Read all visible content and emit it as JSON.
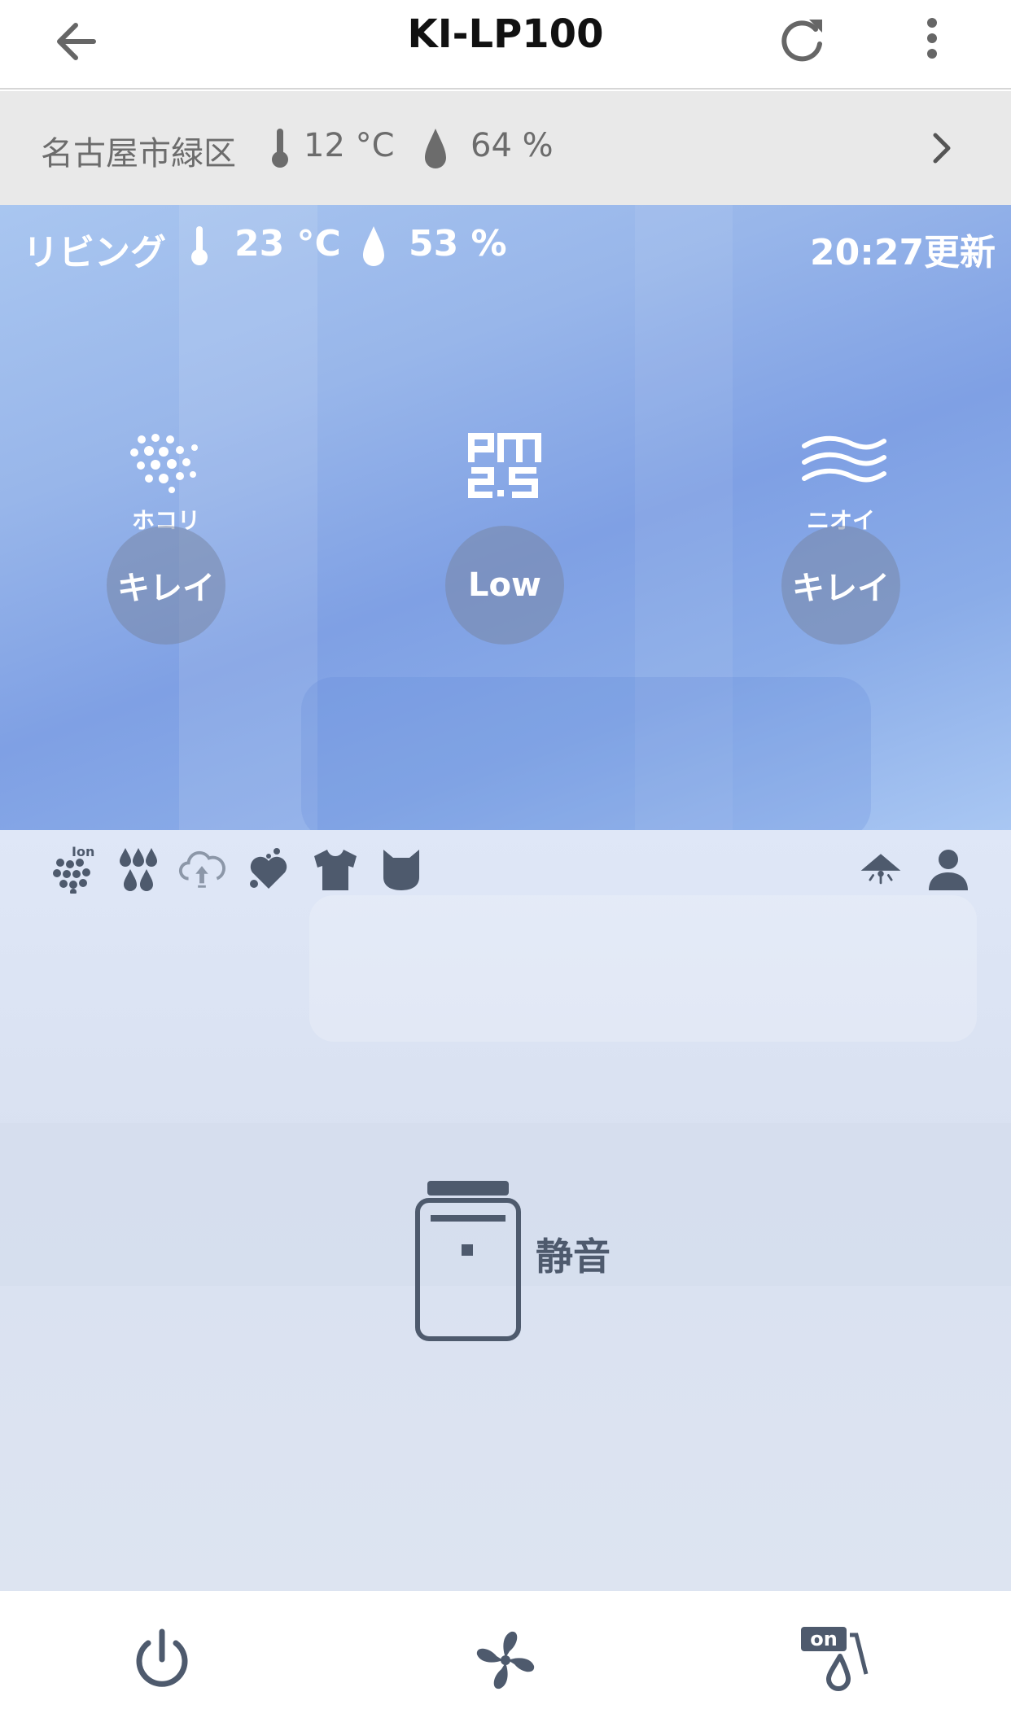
{
  "appbar": {
    "title": "KI-LP100",
    "icons": {
      "back": "arrow-left-icon",
      "refresh": "refresh-icon",
      "menu": "more-vert-icon"
    }
  },
  "outdoor": {
    "location": "名古屋市緑区",
    "temperature": "12 °C",
    "humidity": "64 %"
  },
  "indoor": {
    "room": "リビング",
    "temperature": "23 °C",
    "humidity": "53 %",
    "updated": "20:27更新",
    "sensors": [
      {
        "label": "ホコリ",
        "status": "キレイ",
        "icon": "dust-icon"
      },
      {
        "label": "",
        "status": "Low",
        "icon": "pm25-icon"
      },
      {
        "label": "ニオイ",
        "status": "キレイ",
        "icon": "odor-icon"
      }
    ]
  },
  "status_icons": {
    "ion_text": "Ion",
    "left": [
      "ion-icon",
      "humidify-icon",
      "cloud-circulation-icon",
      "heart-care-icon",
      "clothes-icon",
      "pet-icon"
    ],
    "right": [
      "light-sensor-icon",
      "person-icon"
    ]
  },
  "main": {
    "mode": "静音",
    "device_icon": "air-purifier-icon"
  },
  "bottom": {
    "humidify_toggle": "on",
    "buttons": [
      "power-icon",
      "fan-icon",
      "humidify-toggle-icon"
    ]
  },
  "colors": {
    "indoor_blue": "#8fb0ea",
    "icon_dark": "#4e5a6d",
    "outdoor_bg": "#e9e9e9"
  }
}
